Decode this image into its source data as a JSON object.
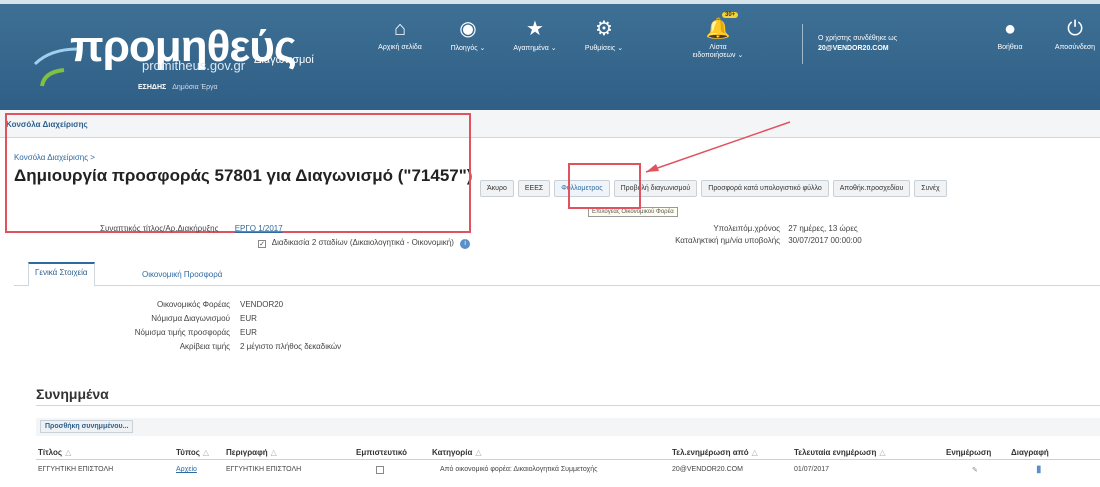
{
  "header": {
    "logo_title": "προμηθεύς",
    "logo_subtitle": "Διαγωνισμοί",
    "logo_url": "promitheus.gov.gr",
    "logo_esidis": "ΕΣΗΔΗΣ",
    "logo_tagline": "Δημόσια Έργα",
    "nav": [
      {
        "icon": "home-icon",
        "glyph": "⌂",
        "label": "Αρχική σελίδα"
      },
      {
        "icon": "navigation-icon",
        "glyph": "◉",
        "label": "Πλοηγός ⌄"
      },
      {
        "icon": "star-icon",
        "glyph": "★",
        "label": "Αγαπημένα ⌄"
      },
      {
        "icon": "gear-icon",
        "glyph": "⚙",
        "label": "Ρυθμίσεις ⌄"
      },
      {
        "icon": "bell-icon",
        "glyph": "🔔",
        "label": "Λίστα ειδοποιήσεων ⌄"
      }
    ],
    "notification_count": "30+",
    "user_label": "Ο χρήστης συνδέθηκε ως",
    "user_name": "20@VENDOR20.COM",
    "help_label": "Βοήθεια",
    "logout_label": "Αποσύνδεση"
  },
  "tab": {
    "label": "Κονσόλα Διαχείρισης"
  },
  "breadcrumb": "Κονσόλα Διαχείρισης >",
  "page_title": "Δημιουργία προσφοράς 57801 για Διαγωνισμό (\"71457\")",
  "actions": [
    {
      "label": "Άκυρο",
      "highlight": false
    },
    {
      "label": "ΕΕΕΣ",
      "highlight": false
    },
    {
      "label": "Φυλλομετρος",
      "highlight": true
    },
    {
      "label": "Προβολή διαγωνισμού",
      "highlight": false
    },
    {
      "label": "Προσφορά κατά υπολογιστικό φύλλο",
      "highlight": false
    },
    {
      "label": "Αποθήκ.προσχεδίου",
      "highlight": false
    },
    {
      "label": "Συνέχ",
      "highlight": false
    }
  ],
  "tooltip": "Επιλογέας Οικονομικού Φορέα",
  "fields": {
    "contact_label": "Συναπτικός τίτλος/Αρ.Διακήρυξης",
    "contact_value": "ΕΡΓΟ 1/2017",
    "checkbox_label": "Διαδικασία 2 σταδίων (Δικαιολογητικά - Οικονομική)",
    "remaining_label": "Υπολειπόμ.χρόνος",
    "remaining_value": "27 ημέρες, 13 ώρες",
    "deadline_label": "Καταληκτική ημ/νία υποβολής",
    "deadline_value": "30/07/2017 00:00:00"
  },
  "subtabs": {
    "general": "Γενικά Στοιχεία",
    "financial": "Οικονομική Προσφορά"
  },
  "general": [
    {
      "label": "Οικονομικός Φορέας",
      "value": "VENDOR20"
    },
    {
      "label": "Νόμισμα Διαγωνισμού",
      "value": "EUR"
    },
    {
      "label": "Νόμισμα τιμής προσφοράς",
      "value": "EUR"
    },
    {
      "label": "Ακρίβεια τιμής",
      "value": "2 μέγιστο πλήθος δεκαδικών"
    }
  ],
  "attachments": {
    "title": "Συνημμένα",
    "add_button": "Προσθήκη συνημμένου...",
    "columns": [
      "Τίτλος",
      "Τύπος",
      "Περιγραφή",
      "Εμπιστευτικό",
      "Κατηγορία",
      "Τελ.ενημέρωση από",
      "Τελευταία ενημέρωση",
      "Ενημέρωση",
      "Διαγραφή"
    ],
    "rows": [
      {
        "title": "ΕΓΓΥΗΤΙΚΗ ΕΠΙΣΤΟΛΗ",
        "type": "Αρχείο",
        "description": "ΕΓΓΥΗΤΙΚΗ ΕΠΙΣΤΟΛΗ",
        "category": "Από οικονομικό φορέα: Δικαιολογητικά Συμμετοχής",
        "updated_by": "20@VENDOR20.COM",
        "updated_on": "01/07/2017"
      }
    ]
  },
  "colors": {
    "header_bg": "#3a6a90",
    "link": "#2d6aa0",
    "annotation": "#e0525e"
  }
}
